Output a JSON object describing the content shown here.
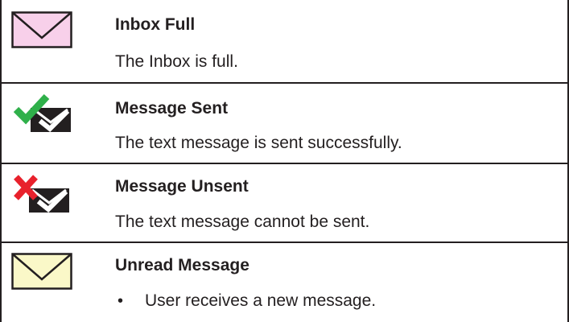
{
  "rows": [
    {
      "icon": "inbox-full-envelope-icon",
      "title": "Inbox Full",
      "description": "The Inbox is full.",
      "icon_fill": "#f8d0ea"
    },
    {
      "icon": "message-sent-icon",
      "title": "Message Sent",
      "description": "The text message is sent successfully.",
      "accent": "#2fb04a"
    },
    {
      "icon": "message-unsent-icon",
      "title": "Message Unsent",
      "description": "The text message cannot be sent.",
      "accent": "#e8212c"
    },
    {
      "icon": "unread-message-envelope-icon",
      "title": "Unread Message",
      "bullets": [
        {
          "marker": "•",
          "text": "User receives a new message."
        }
      ],
      "icon_fill": "#faf8c8"
    }
  ],
  "colors": {
    "border": "#231f20",
    "text": "#231f20"
  }
}
